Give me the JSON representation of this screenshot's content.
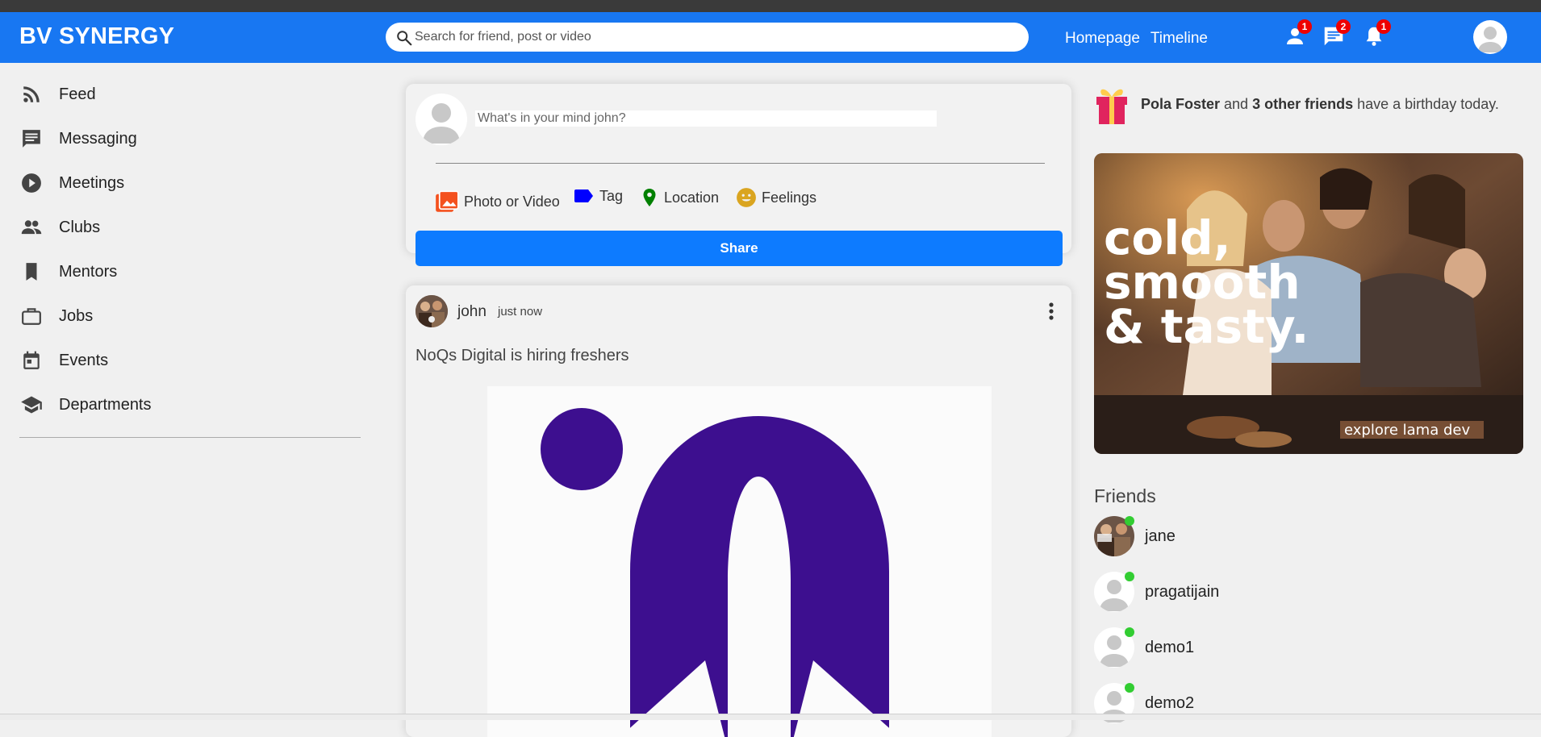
{
  "header": {
    "logo": "BV SYNERGY",
    "search_placeholder": "Search for friend, post or video",
    "nav_links": [
      "Homepage",
      "Timeline"
    ],
    "badges": {
      "friend_requests": "1",
      "messages": "2",
      "notifications": "1"
    },
    "brand_color": "#1877f2"
  },
  "sidebar": {
    "items": [
      {
        "label": "Feed",
        "icon": "rss-icon"
      },
      {
        "label": "Messaging",
        "icon": "chat-icon"
      },
      {
        "label": "Meetings",
        "icon": "play-circle-icon"
      },
      {
        "label": "Clubs",
        "icon": "group-icon"
      },
      {
        "label": "Mentors",
        "icon": "bookmark-icon"
      },
      {
        "label": "Jobs",
        "icon": "briefcase-icon"
      },
      {
        "label": "Events",
        "icon": "calendar-icon"
      },
      {
        "label": "Departments",
        "icon": "school-icon"
      }
    ]
  },
  "share": {
    "placeholder": "What's in your mind john?",
    "options": [
      {
        "label": "Photo or Video",
        "icon": "photo-library-icon",
        "color": "#f4511e"
      },
      {
        "label": "Tag",
        "icon": "label-icon",
        "color": "#0000ff"
      },
      {
        "label": "Location",
        "icon": "location-pin-icon",
        "color": "#008000"
      },
      {
        "label": "Feelings",
        "icon": "emoji-icon",
        "color": "#daa520"
      }
    ],
    "button_label": "Share"
  },
  "post": {
    "username": "john",
    "time": "just now",
    "text": "NoQs Digital is hiring freshers"
  },
  "rightbar": {
    "birthday": {
      "name": "Pola Foster",
      "connector": " and ",
      "others": "3 other friends",
      "suffix": " have a birthday today."
    },
    "ad": {
      "headline_1": "cold,",
      "headline_2": "smooth",
      "headline_3": "& tasty.",
      "footer": "explore lama dev"
    },
    "friends_title": "Friends",
    "friends": [
      {
        "name": "jane",
        "online": true
      },
      {
        "name": "pragatijain",
        "online": true
      },
      {
        "name": "demo1",
        "online": true
      },
      {
        "name": "demo2",
        "online": true
      }
    ]
  }
}
